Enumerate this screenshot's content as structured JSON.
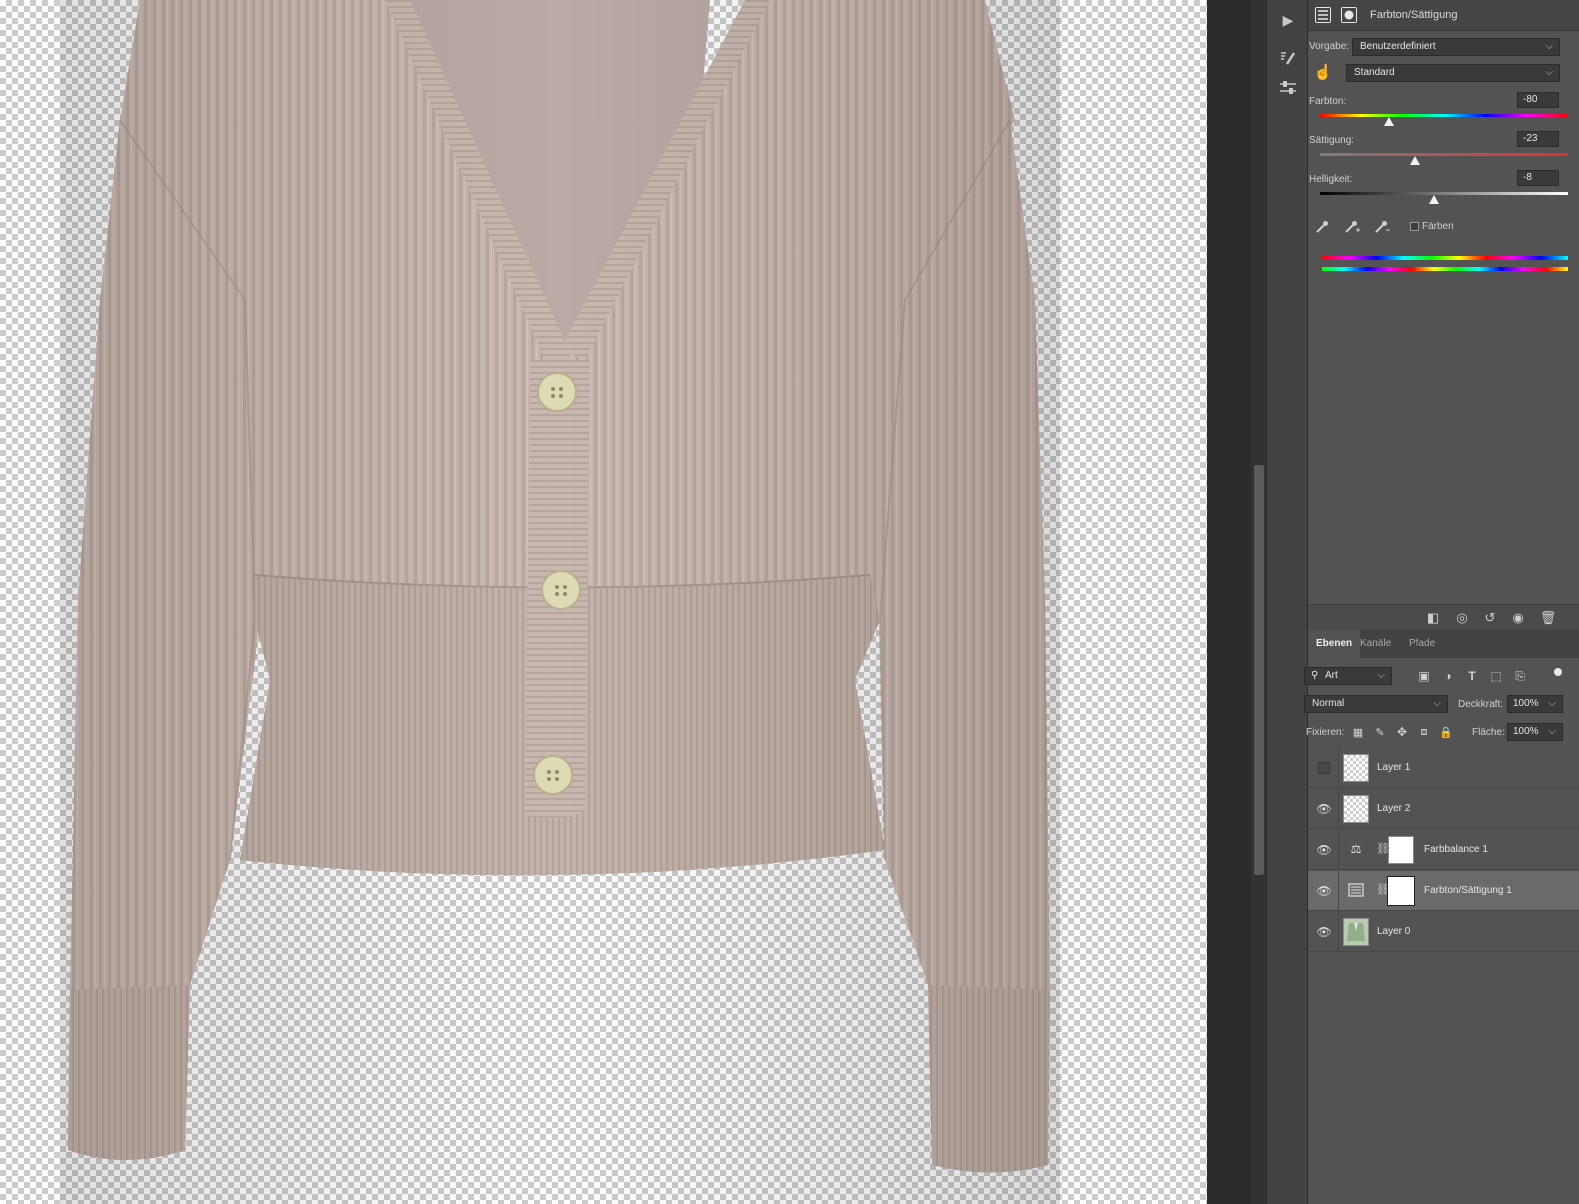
{
  "properties": {
    "title": "Farbton/Sättigung",
    "preset_label": "Vorgabe:",
    "preset_value": "Benutzerdefiniert",
    "range_value": "Standard",
    "hue_label": "Farbton:",
    "hue_value": "-80",
    "hue_level": -80,
    "saturation_label": "Sättigung:",
    "saturation_value": "-23",
    "saturation_level": -23,
    "lightness_label": "Helligkeit:",
    "lightness_value": "-8",
    "lightness_level": -8,
    "colorize_label": "Färben",
    "colorize_checked": false
  },
  "layers_panel": {
    "tabs": [
      {
        "label": "Ebenen",
        "active": true
      },
      {
        "label": "Kanäle",
        "active": false
      },
      {
        "label": "Pfade",
        "active": false
      }
    ],
    "filter_value": "Art",
    "blend_mode": "Normal",
    "opacity_label": "Deckkraft:",
    "opacity_value": "100%",
    "lock_label": "Fixieren:",
    "fill_label": "Fläche:",
    "fill_value": "100%",
    "layers": [
      {
        "name": "Layer 1",
        "visible": false,
        "type": "pixel",
        "selected": false
      },
      {
        "name": "Layer 2",
        "visible": true,
        "type": "pixel",
        "selected": false
      },
      {
        "name": "Farbbalance 1",
        "visible": true,
        "type": "adjustment",
        "selected": false
      },
      {
        "name": "Farbton/Sättigung 1",
        "visible": true,
        "type": "adjustment",
        "selected": true
      },
      {
        "name": "Layer 0",
        "visible": true,
        "type": "image",
        "selected": false
      }
    ]
  },
  "icons": {
    "play": "play-icon",
    "brush_settings": "brush-settings-icon",
    "adjustments": "adjustments-icon",
    "eye": "eye-icon",
    "trash": "trash-icon"
  },
  "colors": {
    "panel_bg": "#535353",
    "selected_layer": "#6a6a6a",
    "cardigan": "#c6b6ad",
    "buttons": "#d9d8b2"
  }
}
